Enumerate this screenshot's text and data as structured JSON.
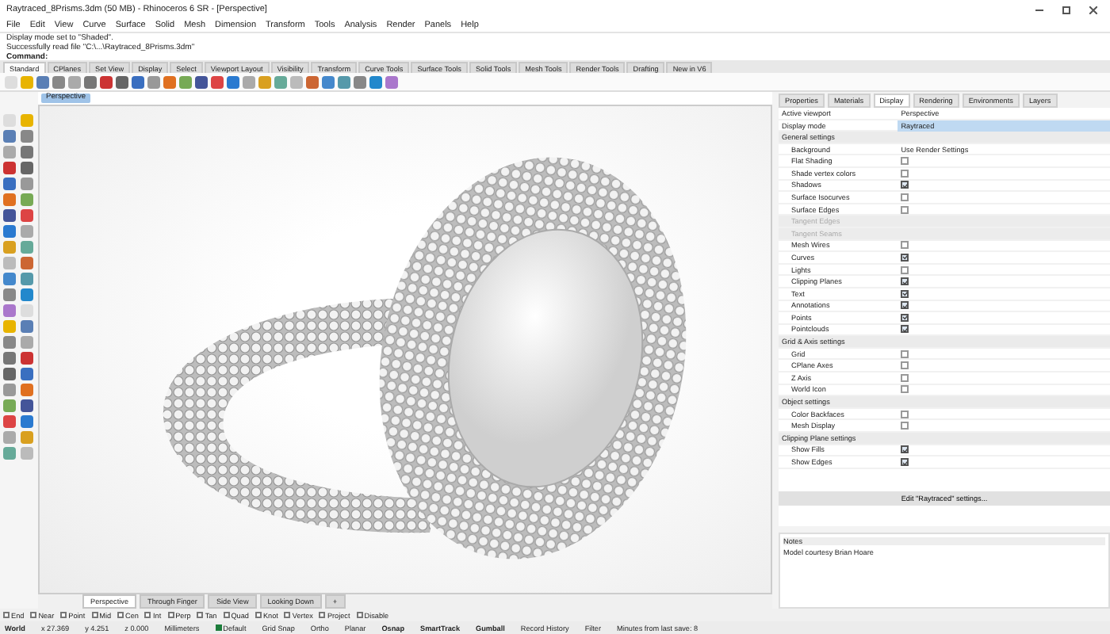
{
  "window": {
    "title": "Raytraced_8Prisms.3dm (50 MB) - Rhinoceros 6 SR - [Perspective]"
  },
  "menu": [
    "File",
    "Edit",
    "View",
    "Curve",
    "Surface",
    "Solid",
    "Mesh",
    "Dimension",
    "Transform",
    "Tools",
    "Analysis",
    "Render",
    "Panels",
    "Help"
  ],
  "command_history": [
    "Display mode set to \"Shaded\".",
    "Successfully read file \"C:\\...\\Raytraced_8Prisms.3dm\"",
    "Command:"
  ],
  "toolbar_tabs": [
    {
      "label": "Standard",
      "selected": true
    },
    {
      "label": "CPlanes",
      "selected": false
    },
    {
      "label": "Set View",
      "selected": false
    },
    {
      "label": "Display",
      "selected": false
    },
    {
      "label": "Select",
      "selected": false
    },
    {
      "label": "Viewport Layout",
      "selected": false
    },
    {
      "label": "Visibility",
      "selected": false
    },
    {
      "label": "Transform",
      "selected": false
    },
    {
      "label": "Curve Tools",
      "selected": false
    },
    {
      "label": "Surface Tools",
      "selected": false
    },
    {
      "label": "Solid Tools",
      "selected": false
    },
    {
      "label": "Mesh Tools",
      "selected": false
    },
    {
      "label": "Render Tools",
      "selected": false
    },
    {
      "label": "Drafting",
      "selected": false
    },
    {
      "label": "New in V6",
      "selected": false
    }
  ],
  "viewport": {
    "title": "Perspective",
    "tabs": [
      {
        "label": "Perspective",
        "selected": true
      },
      {
        "label": "Through Finger",
        "selected": false
      },
      {
        "label": "Side View",
        "selected": false
      },
      {
        "label": "Looking Down",
        "selected": false
      },
      {
        "label": "+",
        "selected": false
      }
    ]
  },
  "panel": {
    "tabs": [
      {
        "label": "Properties",
        "selected": false
      },
      {
        "label": "Materials",
        "selected": false
      },
      {
        "label": "Display",
        "selected": true
      },
      {
        "label": "Rendering",
        "selected": false
      },
      {
        "label": "Environments",
        "selected": false
      },
      {
        "label": "Layers",
        "selected": false
      }
    ],
    "rows": [
      {
        "kind": "value",
        "label": "Active viewport",
        "value": "Perspective",
        "highlight": false
      },
      {
        "kind": "value",
        "label": "Display mode",
        "value": "Raytraced",
        "highlight": true
      },
      {
        "kind": "section",
        "label": "General settings"
      },
      {
        "kind": "value",
        "label": "Background",
        "value": "Use Render Settings",
        "highlight": false
      },
      {
        "kind": "check",
        "label": "Flat Shading",
        "checked": false,
        "disabled": false
      },
      {
        "kind": "check",
        "label": "Shade vertex colors",
        "checked": false,
        "disabled": false
      },
      {
        "kind": "check",
        "label": "Shadows",
        "checked": true,
        "disabled": false
      },
      {
        "kind": "check",
        "label": "Surface Isocurves",
        "checked": false,
        "disabled": false
      },
      {
        "kind": "check",
        "label": "Surface Edges",
        "checked": false,
        "disabled": false
      },
      {
        "kind": "check",
        "label": "Tangent Edges",
        "disabled": true
      },
      {
        "kind": "check",
        "label": "Tangent Seams",
        "disabled": true
      },
      {
        "kind": "check",
        "label": "Mesh Wires",
        "checked": false,
        "disabled": false
      },
      {
        "kind": "check",
        "label": "Curves",
        "checked": true,
        "disabled": false
      },
      {
        "kind": "check",
        "label": "Lights",
        "checked": false,
        "disabled": false
      },
      {
        "kind": "check",
        "label": "Clipping Planes",
        "checked": true,
        "disabled": false
      },
      {
        "kind": "check",
        "label": "Text",
        "checked": true,
        "disabled": false
      },
      {
        "kind": "check",
        "label": "Annotations",
        "checked": true,
        "disabled": false
      },
      {
        "kind": "check",
        "label": "Points",
        "checked": true,
        "disabled": false
      },
      {
        "kind": "check",
        "label": "Pointclouds",
        "checked": true,
        "disabled": false
      },
      {
        "kind": "section",
        "label": "Grid & Axis settings"
      },
      {
        "kind": "check",
        "label": "Grid",
        "checked": false,
        "disabled": false
      },
      {
        "kind": "check",
        "label": "CPlane Axes",
        "checked": false,
        "disabled": false
      },
      {
        "kind": "check",
        "label": "Z Axis",
        "checked": false,
        "disabled": false
      },
      {
        "kind": "check",
        "label": "World Icon",
        "checked": false,
        "disabled": false
      },
      {
        "kind": "section",
        "label": "Object settings"
      },
      {
        "kind": "check",
        "label": "Color Backfaces",
        "checked": false,
        "disabled": false
      },
      {
        "kind": "check",
        "label": "Mesh Display",
        "checked": false,
        "disabled": false
      },
      {
        "kind": "section",
        "label": "Clipping Plane settings"
      },
      {
        "kind": "check",
        "label": "Show Fills",
        "checked": true,
        "disabled": false
      },
      {
        "kind": "check",
        "label": "Show Edges",
        "checked": true,
        "disabled": false
      }
    ],
    "edit_button": "Edit \"Raytraced\" settings...",
    "notes": {
      "title": "Notes",
      "text": "Model courtesy Brian Hoare"
    }
  },
  "osnaps": [
    {
      "label": "End",
      "checked": false
    },
    {
      "label": "Near",
      "checked": false
    },
    {
      "label": "Point",
      "checked": false
    },
    {
      "label": "Mid",
      "checked": false
    },
    {
      "label": "Cen",
      "checked": false
    },
    {
      "label": "Int",
      "checked": false
    },
    {
      "label": "Perp",
      "checked": false
    },
    {
      "label": "Tan",
      "checked": false
    },
    {
      "label": "Quad",
      "checked": false
    },
    {
      "label": "Knot",
      "checked": false
    },
    {
      "label": "Vertex",
      "checked": false
    },
    {
      "label": "Project",
      "checked": false
    },
    {
      "label": "Disable",
      "checked": false
    }
  ],
  "status_bar": {
    "cplane": "World",
    "x": "x 27.369",
    "y": "y 4.251",
    "z": "z 0.000",
    "units": "Millimeters",
    "layer": "Default",
    "toggles": [
      {
        "label": "Grid Snap",
        "on": false
      },
      {
        "label": "Ortho",
        "on": false
      },
      {
        "label": "Planar",
        "on": false
      },
      {
        "label": "Osnap",
        "on": true
      },
      {
        "label": "SmartTrack",
        "on": true
      },
      {
        "label": "Gumball",
        "on": true
      },
      {
        "label": "Record History",
        "on": false
      },
      {
        "label": "Filter",
        "on": false
      }
    ],
    "message": "Minutes from last save: 8"
  }
}
